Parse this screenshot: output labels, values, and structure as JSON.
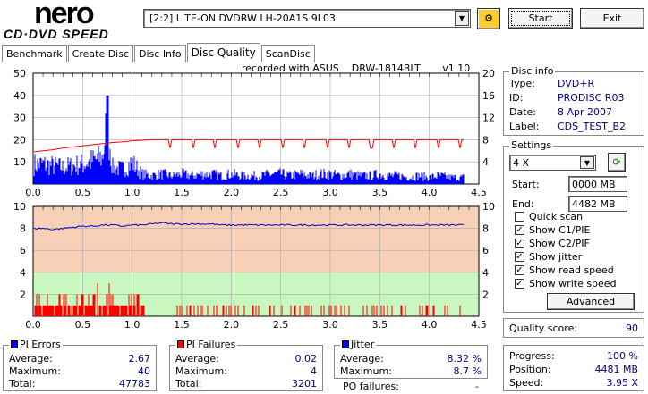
{
  "app": {
    "logo_top": "nero",
    "logo_bottom": "CD·DVD SPEED"
  },
  "drive": {
    "selected": "[2:2]  LITE-ON DVDRW LH-20A1S 9L03"
  },
  "buttons": {
    "start": "Start",
    "exit": "Exit",
    "advanced": "Advanced"
  },
  "tabs": [
    {
      "label": "Benchmark"
    },
    {
      "label": "Create Disc"
    },
    {
      "label": "Disc Info"
    },
    {
      "label": "Disc Quality"
    },
    {
      "label": "ScanDisc"
    }
  ],
  "recorded": {
    "prefix": "recorded with ASUS",
    "model": "DRW-1814BLT",
    "version": "v1.10"
  },
  "disc_info": {
    "title": "Disc info",
    "type_label": "Type:",
    "type": "DVD+R",
    "id_label": "ID:",
    "id": "PRODISC R03",
    "date_label": "Date:",
    "date": "8 Apr 2007",
    "label_label": "Label:",
    "label": "CDS_TEST_B2"
  },
  "settings": {
    "title": "Settings",
    "speed": "4 X",
    "start_label": "Start:",
    "start": "0000 MB",
    "end_label": "End:",
    "end": "4482 MB",
    "checks": [
      {
        "label": "Quick scan",
        "checked": false
      },
      {
        "label": "Show C1/PIE",
        "checked": true
      },
      {
        "label": "Show C2/PIF",
        "checked": true
      },
      {
        "label": "Show jitter",
        "checked": true
      },
      {
        "label": "Show read speed",
        "checked": true
      },
      {
        "label": "Show write speed",
        "checked": true
      }
    ]
  },
  "quality": {
    "label": "Quality score:",
    "value": "90"
  },
  "progress": {
    "progress_label": "Progress:",
    "progress": "100 %",
    "position_label": "Position:",
    "position": "4481 MB",
    "speed_label": "Speed:",
    "speed": "3.95 X"
  },
  "pi_errors": {
    "title": "PI Errors",
    "color": "#0000ff",
    "avg_label": "Average:",
    "avg": "2.67",
    "max_label": "Maximum:",
    "max": "40",
    "total_label": "Total:",
    "total": "47783"
  },
  "pi_failures": {
    "title": "PI Failures",
    "color": "#ff0000",
    "avg_label": "Average:",
    "avg": "0.02",
    "max_label": "Maximum:",
    "max": "4",
    "total_label": "Total:",
    "total": "3201"
  },
  "jitter": {
    "title": "Jitter",
    "color": "#0000ff",
    "avg_label": "Average:",
    "avg": "8.32 %",
    "max_label": "Maximum:",
    "max": "8.7 %",
    "po_label": "PO failures:",
    "po": "-"
  },
  "chart_data": [
    {
      "type": "bar",
      "name": "PI errors / read speed",
      "xlim": [
        0,
        4.5
      ],
      "ylim_left": [
        0,
        50
      ],
      "ylim_right": [
        0,
        20
      ],
      "xticks": [
        "0.0",
        "0.5",
        "1.0",
        "1.5",
        "2.0",
        "2.5",
        "3.0",
        "3.5",
        "4.0",
        "4.5"
      ],
      "yticks_left": [
        "10",
        "20",
        "30",
        "40",
        "50"
      ],
      "yticks_right": [
        "4",
        "8",
        "12",
        "16",
        "20"
      ],
      "x": [
        0.0,
        0.1,
        0.2,
        0.3,
        0.4,
        0.5,
        0.6,
        0.7,
        0.75,
        0.8,
        0.9,
        1.0,
        1.1,
        1.2,
        1.3,
        1.4,
        1.5,
        1.6,
        1.7,
        1.8,
        1.9,
        2.0,
        2.1,
        2.2,
        2.3,
        2.4,
        2.5,
        2.6,
        2.7,
        2.8,
        2.9,
        3.0,
        3.1,
        3.2,
        3.3,
        3.4,
        3.5,
        3.6,
        3.7,
        3.8,
        3.9,
        4.0,
        4.1,
        4.2,
        4.3,
        4.35
      ],
      "pie": [
        12,
        12,
        11,
        10,
        11,
        12,
        14,
        16,
        40,
        10,
        9,
        13,
        6,
        5,
        6,
        5,
        6,
        5,
        6,
        6,
        5,
        6,
        5,
        5,
        5,
        6,
        6,
        5,
        6,
        5,
        6,
        6,
        5,
        6,
        5,
        5,
        6,
        5,
        5,
        4,
        5,
        4,
        5,
        4,
        4,
        4
      ],
      "read_speed": [
        5.8,
        6.0,
        6.2,
        6.5,
        6.7,
        6.9,
        7.1,
        7.3,
        7.4,
        7.5,
        7.6,
        7.8,
        7.9,
        8.0,
        8.0,
        8.0,
        8.0,
        8.0,
        8.0,
        8.0,
        8.0,
        8.0,
        8.0,
        8.0,
        8.0,
        8.0,
        8.0,
        8.0,
        8.0,
        8.0,
        8.0,
        8.0,
        8.0,
        8.0,
        8.0,
        8.0,
        8.0,
        8.0,
        8.0,
        8.0,
        8.0,
        8.0,
        8.0,
        8.0,
        8.0,
        8.0
      ]
    },
    {
      "type": "bar",
      "name": "PI failures / jitter",
      "xlim": [
        0,
        4.5
      ],
      "ylim": [
        0,
        10
      ],
      "xticks": [
        "0.0",
        "0.5",
        "1.0",
        "1.5",
        "2.0",
        "2.5",
        "3.0",
        "3.5",
        "4.0",
        "4.5"
      ],
      "yticks": [
        "2",
        "4",
        "6",
        "8",
        "10"
      ],
      "x": [
        0.0,
        0.1,
        0.2,
        0.3,
        0.4,
        0.5,
        0.6,
        0.7,
        0.8,
        0.9,
        1.0,
        1.1,
        1.2,
        1.3,
        1.4,
        1.5,
        1.6,
        1.7,
        1.8,
        1.9,
        2.0,
        2.1,
        2.2,
        2.3,
        2.4,
        2.5,
        2.6,
        2.7,
        2.8,
        2.9,
        3.0,
        3.1,
        3.2,
        3.3,
        3.4,
        3.5,
        3.6,
        3.7,
        3.8,
        3.9,
        4.0,
        4.1,
        4.2,
        4.3,
        4.35
      ],
      "pif": [
        2,
        2,
        2,
        2,
        2,
        2,
        3,
        4,
        2,
        1,
        3,
        2,
        1,
        1,
        1,
        1,
        1,
        1,
        1,
        1,
        1,
        1,
        1,
        1,
        1,
        1,
        1,
        1,
        1,
        1,
        1,
        1,
        1,
        1,
        1,
        1,
        1,
        1,
        1,
        1,
        1,
        1,
        1,
        1,
        1
      ],
      "jitter": [
        8.0,
        8.0,
        7.9,
        8.0,
        8.1,
        8.2,
        8.2,
        8.3,
        8.3,
        8.2,
        8.3,
        8.3,
        8.4,
        8.5,
        8.4,
        8.4,
        8.4,
        8.4,
        8.4,
        8.3,
        8.3,
        8.3,
        8.3,
        8.3,
        8.3,
        8.3,
        8.3,
        8.3,
        8.3,
        8.3,
        8.3,
        8.3,
        8.3,
        8.3,
        8.3,
        8.3,
        8.3,
        8.3,
        8.3,
        8.3,
        8.3,
        8.3,
        8.3,
        8.3,
        8.3
      ]
    }
  ]
}
